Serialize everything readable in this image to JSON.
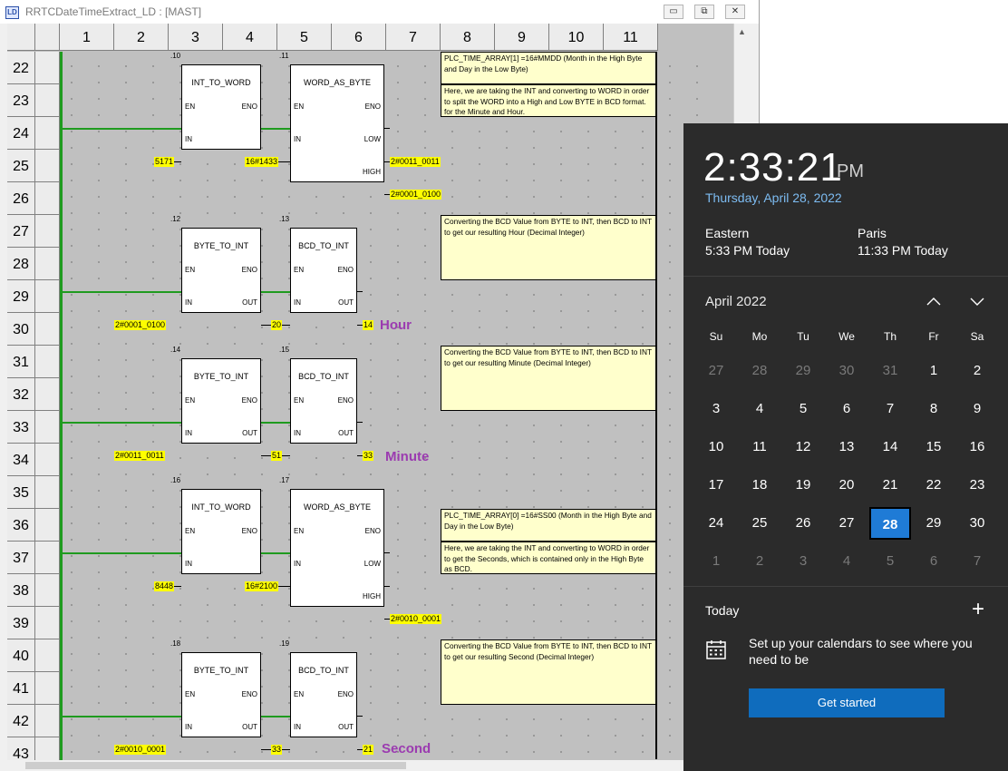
{
  "window": {
    "title": "RRTCDateTimeExtract_LD : [MAST]",
    "icon_text": "LD",
    "btn_minimize": "▭",
    "btn_restore": "⧉",
    "btn_close": "✕"
  },
  "grid": {
    "columns": [
      "1",
      "2",
      "3",
      "4",
      "5",
      "6",
      "7",
      "8",
      "9",
      "10",
      "11"
    ],
    "rows": [
      "22",
      "23",
      "24",
      "25",
      "26",
      "27",
      "28",
      "29",
      "30",
      "31",
      "32",
      "33",
      "34",
      "35",
      "36",
      "37",
      "38",
      "39",
      "40",
      "41",
      "42",
      "43"
    ]
  },
  "blocks": [
    {
      "inst": ".10",
      "name": "INT_TO_WORD",
      "pin_en": "EN",
      "pin_eno": "ENO",
      "pin_in": "IN",
      "pin_out": ""
    },
    {
      "inst": ".11",
      "name": "WORD_AS_BYTE",
      "pin_en": "EN",
      "pin_eno": "ENO",
      "pin_in": "IN",
      "pin_low": "LOW",
      "pin_high": "HIGH"
    },
    {
      "inst": ".12",
      "name": "BYTE_TO_INT",
      "pin_en": "EN",
      "pin_eno": "ENO",
      "pin_in": "IN",
      "pin_out": "OUT"
    },
    {
      "inst": ".13",
      "name": "BCD_TO_INT",
      "pin_en": "EN",
      "pin_eno": "ENO",
      "pin_in": "IN",
      "pin_out": "OUT"
    },
    {
      "inst": ".14",
      "name": "BYTE_TO_INT",
      "pin_en": "EN",
      "pin_eno": "ENO",
      "pin_in": "IN",
      "pin_out": "OUT"
    },
    {
      "inst": ".15",
      "name": "BCD_TO_INT",
      "pin_en": "EN",
      "pin_eno": "ENO",
      "pin_in": "IN",
      "pin_out": "OUT"
    },
    {
      "inst": ".16",
      "name": "INT_TO_WORD",
      "pin_en": "EN",
      "pin_eno": "ENO",
      "pin_in": "IN",
      "pin_out": ""
    },
    {
      "inst": ".17",
      "name": "WORD_AS_BYTE",
      "pin_en": "EN",
      "pin_eno": "ENO",
      "pin_in": "IN",
      "pin_low": "LOW",
      "pin_high": "HIGH"
    },
    {
      "inst": ".18",
      "name": "BYTE_TO_INT",
      "pin_en": "EN",
      "pin_eno": "ENO",
      "pin_in": "IN",
      "pin_out": "OUT"
    },
    {
      "inst": ".19",
      "name": "BCD_TO_INT",
      "pin_en": "EN",
      "pin_eno": "ENO",
      "pin_in": "IN",
      "pin_out": "OUT"
    }
  ],
  "values": {
    "v1": "5171",
    "v2": "16#1433",
    "v3": "2#0011_0011",
    "v4": "2#0001_0100",
    "v5": "2#0001_0100",
    "v6": "20",
    "v7": "14",
    "v8": "2#0011_0011",
    "v9": "51",
    "v10": "33",
    "v11": "8448",
    "v12": "16#2100",
    "v13": "2#0010_0001",
    "v14": "2#0010_0001",
    "v15": "33",
    "v16": "21"
  },
  "labels": {
    "hour": "Hour",
    "minute": "Minute",
    "second": "Second"
  },
  "comments": {
    "c1": "PLC_TIME_ARRAY[1] =16#MMDD (Month in the High Byte and Day in the Low Byte)",
    "c2": "Here, we are taking the INT and converting to WORD in order to split the WORD into a High  and  Low BYTE in BCD format.  for the Minute and Hour.",
    "c3": "Converting the BCD Value from BYTE to INT, then BCD to INT to get our resulting Hour (Decimal Integer)",
    "c4": "Converting the BCD Value from BYTE to INT, then BCD to INT to get our resulting Minute (Decimal Integer)",
    "c5": "PLC_TIME_ARRAY[0] =16#SS00 (Month in the High Byte and Day in the Low Byte)",
    "c6": "Here, we are taking the INT and converting to WORD in order to get the Seconds, which is contained only in the High Byte as BCD.",
    "c7": "Converting the BCD Value from BYTE to INT, then BCD to INT to get our resulting Second (Decimal Integer)"
  },
  "flyout": {
    "time": "2:33:21",
    "ampm": "PM",
    "date": "Thursday, April 28, 2022",
    "clocks": [
      {
        "name": "Eastern",
        "time": "5:33 PM Today"
      },
      {
        "name": "Paris",
        "time": "11:33 PM Today"
      }
    ],
    "month": "April 2022",
    "weekdays": [
      "Su",
      "Mo",
      "Tu",
      "We",
      "Th",
      "Fr",
      "Sa"
    ],
    "days": [
      [
        "27",
        "28",
        "29",
        "30",
        "31",
        "1",
        "2"
      ],
      [
        "3",
        "4",
        "5",
        "6",
        "7",
        "8",
        "9"
      ],
      [
        "10",
        "11",
        "12",
        "13",
        "14",
        "15",
        "16"
      ],
      [
        "17",
        "18",
        "19",
        "20",
        "21",
        "22",
        "23"
      ],
      [
        "24",
        "25",
        "26",
        "27",
        "28",
        "29",
        "30"
      ],
      [
        "1",
        "2",
        "3",
        "4",
        "5",
        "6",
        "7"
      ]
    ],
    "today_label": "Today",
    "plus": "+",
    "setup_text": "Set up your calendars to see where you need to be",
    "get_started": "Get started",
    "colors": {
      "bg": "#2b2b2b",
      "accent": "#1f7bd6",
      "date_link": "#7dbcf2",
      "button": "#0f6cbd"
    }
  }
}
